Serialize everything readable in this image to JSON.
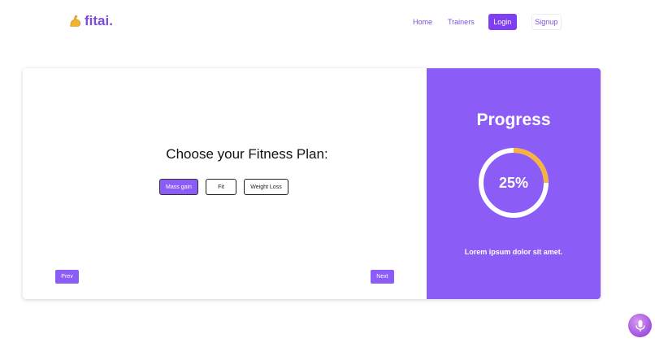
{
  "brand": {
    "name": "fitai.",
    "color": "#7c4ddb"
  },
  "nav": {
    "home": "Home",
    "trainers": "Trainers",
    "login": "Login",
    "signup": "Signup"
  },
  "plan": {
    "title": "Choose your Fitness Plan:",
    "options": [
      "Mass gain",
      "Fit",
      "Weight Loss"
    ],
    "selected": "Mass gain"
  },
  "controls": {
    "prev": "Prev",
    "next": "Next"
  },
  "progress": {
    "title": "Progress",
    "percent_label": "25%",
    "value": 0.25,
    "caption": "Lorem ipsum dolor sit amet."
  },
  "icons": {
    "logo": "flexed-biceps-icon",
    "mic": "microphone-icon"
  },
  "colors": {
    "accent": "#8b5cf6",
    "gauge_fill": "#f6b33f",
    "login_bg": "#7d3ff0"
  }
}
